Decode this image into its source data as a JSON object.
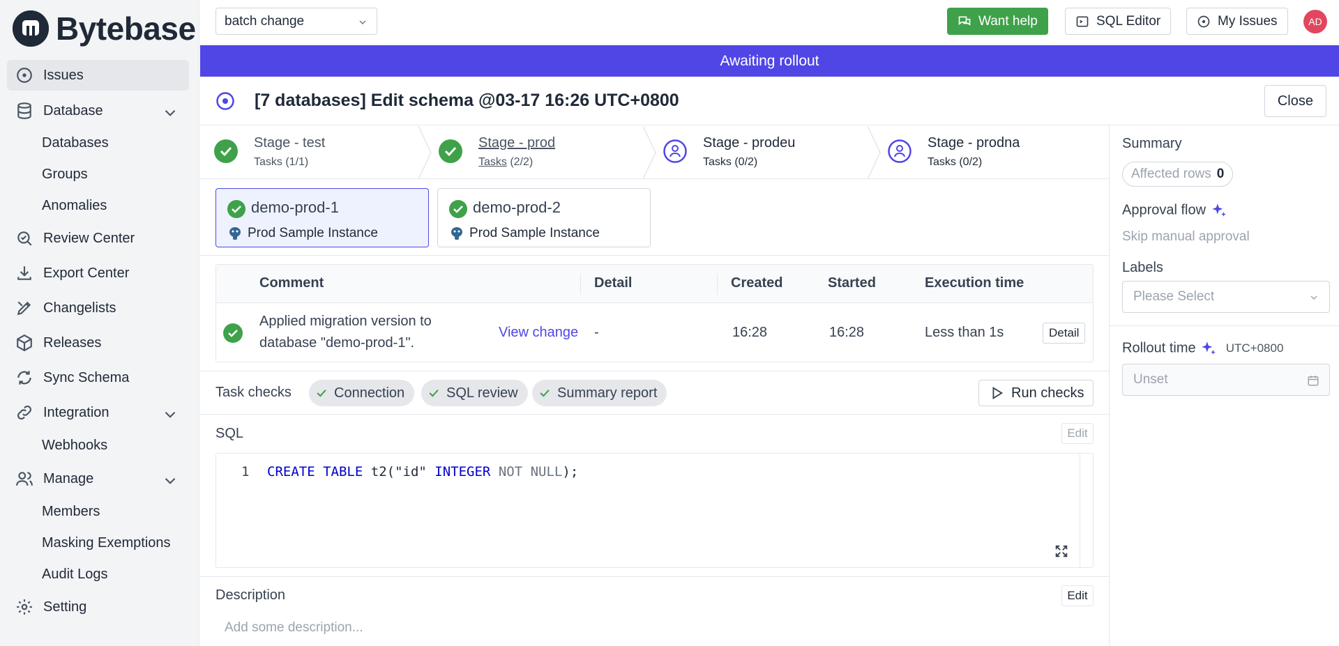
{
  "brand": {
    "name": "Bytebase"
  },
  "sidebar": {
    "items": [
      {
        "label": "Issues",
        "icon": "circle-dot-icon"
      },
      {
        "label": "Database",
        "icon": "database-icon"
      },
      {
        "label": "Review Center",
        "icon": "search-icon"
      },
      {
        "label": "Export Center",
        "icon": "download-icon"
      },
      {
        "label": "Changelists",
        "icon": "pen-tool-icon"
      },
      {
        "label": "Releases",
        "icon": "package-icon"
      },
      {
        "label": "Sync Schema",
        "icon": "refresh-icon"
      },
      {
        "label": "Integration",
        "icon": "link-icon"
      },
      {
        "label": "Manage",
        "icon": "users-icon"
      },
      {
        "label": "Setting",
        "icon": "gear-icon"
      }
    ],
    "database_sub": [
      "Databases",
      "Groups",
      "Anomalies"
    ],
    "integration_sub": [
      "Webhooks"
    ],
    "manage_sub": [
      "Members",
      "Masking Exemptions",
      "Audit Logs"
    ]
  },
  "topbar": {
    "project": "batch change",
    "want_help": "Want help",
    "sql_editor": "SQL Editor",
    "my_issues": "My Issues",
    "avatar": "AD"
  },
  "banner": "Awaiting rollout",
  "issue": {
    "title": "[7 databases] Edit schema @03-17 16:26 UTC+0800",
    "close_label": "Close"
  },
  "stages": [
    {
      "name": "Stage - test",
      "tasks": "Tasks (1/1)",
      "status": "done"
    },
    {
      "name": "Stage - prod",
      "tasks": "Tasks (2/2)",
      "status": "done"
    },
    {
      "name": "Stage - prodeu",
      "tasks": "Tasks (0/2)",
      "status": "pending"
    },
    {
      "name": "Stage - prodna",
      "tasks": "Tasks (0/2)",
      "status": "pending"
    }
  ],
  "tasks": [
    {
      "name": "demo-prod-1",
      "instance": "Prod Sample Instance"
    },
    {
      "name": "demo-prod-2",
      "instance": "Prod Sample Instance"
    }
  ],
  "run_table": {
    "headers": [
      "Comment",
      "Detail",
      "Created",
      "Started",
      "Execution time"
    ],
    "row": {
      "comment_line1": "Applied migration version to",
      "comment_line2": "database \"demo-prod-1\".",
      "view_change": "View change",
      "detail": "-",
      "created": "16:28",
      "started": "16:28",
      "execution_time": "Less than 1s",
      "detail_button": "Detail"
    }
  },
  "checks": {
    "label": "Task checks",
    "items": [
      "Connection",
      "SQL review",
      "Summary report"
    ],
    "run_label": "Run checks"
  },
  "sql": {
    "label": "SQL",
    "edit_label": "Edit",
    "line_number": "1",
    "tokens": [
      "CREATE",
      "TABLE",
      "t2(",
      "\"id\"",
      "INTEGER",
      "NOT",
      "NULL",
      ");"
    ]
  },
  "description": {
    "label": "Description",
    "edit_label": "Edit",
    "placeholder": "Add some description..."
  },
  "right_panel": {
    "summary_label": "Summary",
    "affected_rows_label": "Affected rows",
    "affected_rows_value": "0",
    "approval_flow_label": "Approval flow",
    "approval_flow_value": "Skip manual approval",
    "labels_label": "Labels",
    "labels_placeholder": "Please Select",
    "rollout_time_label": "Rollout time",
    "rollout_tz": "UTC+0800",
    "rollout_value": "Unset"
  },
  "colors": {
    "accent": "#4f46e5",
    "success": "#3fa14a",
    "avatar": "#e0475e"
  }
}
